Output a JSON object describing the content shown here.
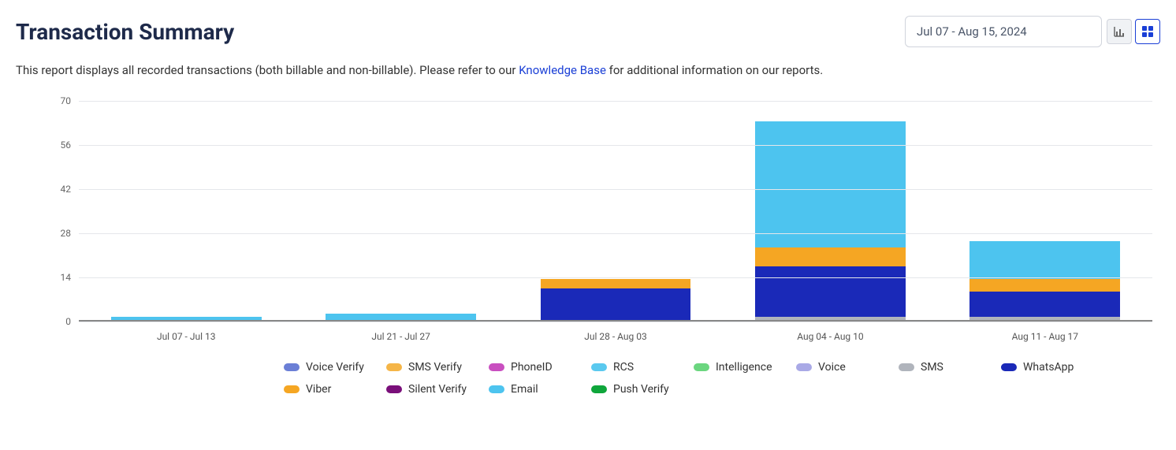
{
  "header": {
    "title": "Transaction Summary",
    "date_range": "Jul 07 - Aug 15, 2024"
  },
  "description": {
    "prefix": "This report displays all recorded transactions (both billable and non-billable). Please refer to our ",
    "link_text": "Knowledge Base",
    "suffix": " for additional information on our reports."
  },
  "chart_data": {
    "type": "bar",
    "stacked": true,
    "ylabel": "",
    "xlabel": "",
    "ylim": [
      0,
      70
    ],
    "y_ticks": [
      0,
      14,
      28,
      42,
      56,
      70
    ],
    "categories": [
      "Jul 07 - Jul 13",
      "Jul 21 - Jul 27",
      "Jul 28 - Aug 03",
      "Aug 04 - Aug 10",
      "Aug 11 - Aug 17"
    ],
    "series": [
      {
        "name": "Voice Verify",
        "color": "#6b7fd6",
        "values": [
          0,
          0,
          0,
          0,
          0
        ]
      },
      {
        "name": "SMS Verify",
        "color": "#f5b547",
        "values": [
          0,
          0,
          0,
          0,
          0
        ]
      },
      {
        "name": "PhoneID",
        "color": "#c94fc0",
        "values": [
          0,
          0,
          0,
          0,
          0
        ]
      },
      {
        "name": "RCS",
        "color": "#5ac9ef",
        "values": [
          0,
          0,
          0,
          0,
          0
        ]
      },
      {
        "name": "Intelligence",
        "color": "#6bd67f",
        "values": [
          0,
          0,
          0,
          0,
          0
        ]
      },
      {
        "name": "Voice",
        "color": "#a9a9e6",
        "values": [
          0,
          0,
          0,
          0,
          0
        ]
      },
      {
        "name": "SMS",
        "color": "#b0b4bc",
        "values": [
          0,
          0,
          0,
          1,
          1
        ]
      },
      {
        "name": "WhatsApp",
        "color": "#1a29b8",
        "values": [
          0,
          0,
          10,
          16,
          8
        ]
      },
      {
        "name": "Viber",
        "color": "#f5a623",
        "values": [
          0,
          0,
          3,
          6,
          4
        ]
      },
      {
        "name": "Silent Verify",
        "color": "#7a0f7a",
        "values": [
          0,
          0,
          0,
          0,
          0
        ]
      },
      {
        "name": "Email",
        "color": "#4dc4ef",
        "values": [
          1,
          2,
          0,
          40,
          12
        ]
      },
      {
        "name": "Push Verify",
        "color": "#0fa63b",
        "values": [
          0,
          0,
          0,
          0,
          0
        ]
      }
    ]
  },
  "view_toggle": {
    "chart_icon_label": "bar-chart-icon",
    "grid_icon_label": "grid-icon"
  }
}
